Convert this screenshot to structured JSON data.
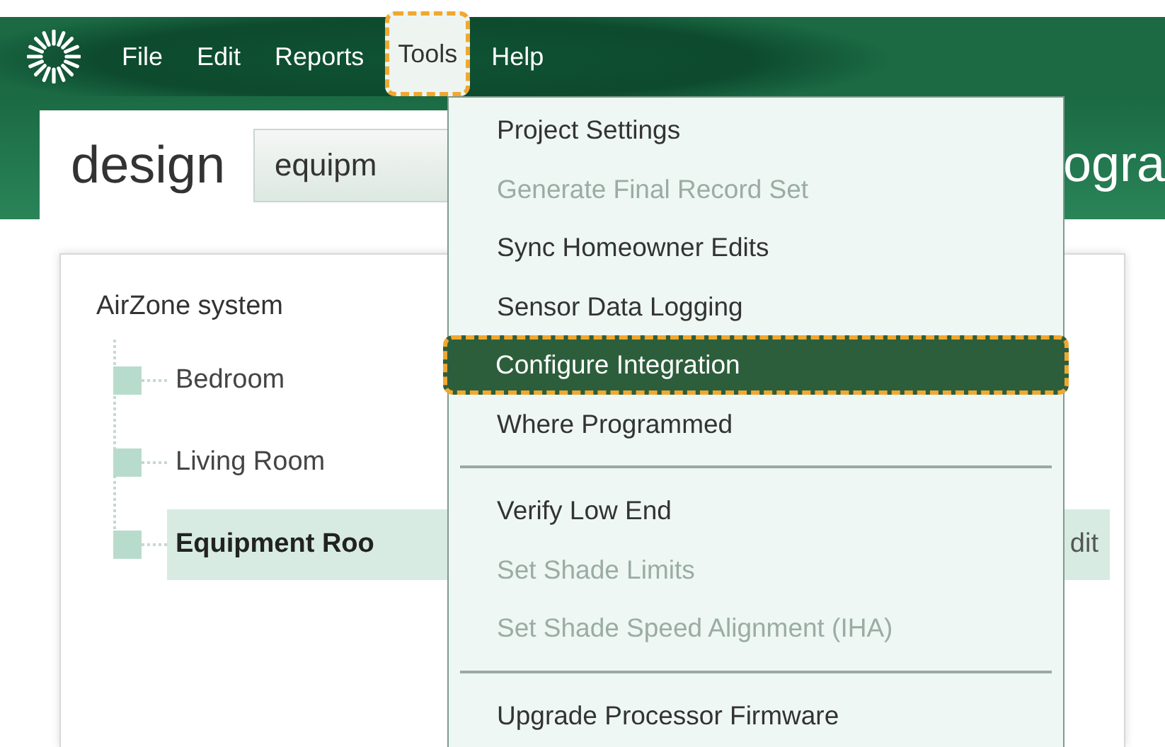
{
  "menu_bar": {
    "items": [
      {
        "label": "File",
        "selected": false,
        "highlighted": false
      },
      {
        "label": "Edit",
        "selected": false,
        "highlighted": false
      },
      {
        "label": "Reports",
        "selected": false,
        "highlighted": false
      },
      {
        "label": "Tools",
        "selected": true,
        "highlighted": true
      },
      {
        "label": "Help",
        "selected": false,
        "highlighted": false
      }
    ]
  },
  "header": {
    "title": "design",
    "tab_label": "equipm",
    "right_label": "ogra"
  },
  "tree": {
    "root": "AirZone system",
    "children": [
      {
        "label": "Bedroom",
        "selected": false
      },
      {
        "label": "Living Room",
        "selected": false
      },
      {
        "label": "Equipment Roo",
        "selected": true,
        "action": "dit"
      }
    ]
  },
  "menu": {
    "items": [
      {
        "kind": "item",
        "label": "Project Settings",
        "disabled": false,
        "selected": false,
        "highlighted": false
      },
      {
        "kind": "item",
        "label": "Generate Final Record Set",
        "disabled": true,
        "selected": false,
        "highlighted": false
      },
      {
        "kind": "item",
        "label": "Sync Homeowner Edits",
        "disabled": false,
        "selected": false,
        "highlighted": false
      },
      {
        "kind": "item",
        "label": "Sensor Data Logging",
        "disabled": false,
        "selected": false,
        "highlighted": false
      },
      {
        "kind": "item",
        "label": "Configure Integration",
        "disabled": false,
        "selected": true,
        "highlighted": true
      },
      {
        "kind": "item",
        "label": "Where Programmed",
        "disabled": false,
        "selected": false,
        "highlighted": false
      },
      {
        "kind": "separator"
      },
      {
        "kind": "item",
        "label": "Verify Low End",
        "disabled": false,
        "selected": false,
        "highlighted": false
      },
      {
        "kind": "item",
        "label": "Set Shade Limits",
        "disabled": true,
        "selected": false,
        "highlighted": false
      },
      {
        "kind": "item",
        "label": "Set Shade Speed Alignment (IHA)",
        "disabled": true,
        "selected": false,
        "highlighted": false
      },
      {
        "kind": "separator"
      },
      {
        "kind": "item",
        "label": "Upgrade Processor Firmware",
        "disabled": false,
        "selected": false,
        "highlighted": false
      }
    ]
  }
}
